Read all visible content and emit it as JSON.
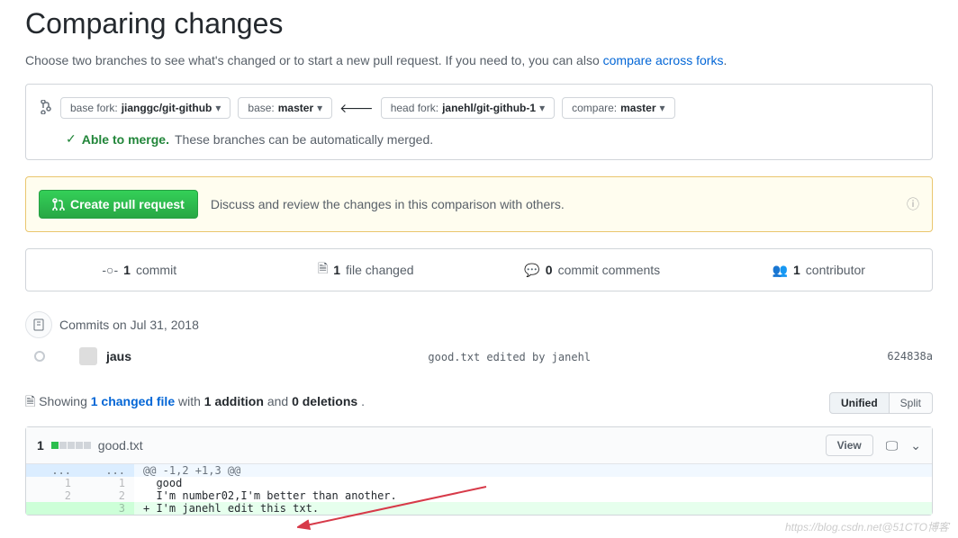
{
  "page": {
    "title": "Comparing changes",
    "subtitle_prefix": "Choose two branches to see what's changed or to start a new pull request. If you need to, you can also ",
    "compare_link": "compare across forks",
    "period": "."
  },
  "compare": {
    "base_fork_label": "base fork:",
    "base_fork_value": "jianggc/git-github",
    "base_label": "base:",
    "base_value": "master",
    "head_fork_label": "head fork:",
    "head_fork_value": "janehl/git-github-1",
    "compare_label": "compare:",
    "compare_value": "master"
  },
  "merge": {
    "status": "Able to merge.",
    "detail": "These branches can be automatically merged."
  },
  "pr": {
    "button": "Create pull request",
    "text": "Discuss and review the changes in this comparison with others."
  },
  "tabs": {
    "commits_count": "1",
    "commits_label": "commit",
    "files_count": "1",
    "files_label": "file changed",
    "comments_count": "0",
    "comments_label": "commit comments",
    "contrib_count": "1",
    "contrib_label": "contributor"
  },
  "commits": {
    "date_label": "Commits on Jul 31, 2018",
    "items": [
      {
        "author": "jaus",
        "message": "good.txt edited by janehl",
        "sha": "624838a"
      }
    ]
  },
  "changes": {
    "showing": "Showing ",
    "file_link": "1 changed file",
    "with": " with ",
    "additions": "1 addition",
    "and": " and ",
    "deletions": "0 deletions",
    "period": ".",
    "unified": "Unified",
    "split": "Split"
  },
  "file": {
    "count": "1",
    "name": "good.txt",
    "view": "View",
    "hunk": "@@ -1,2 +1,3 @@",
    "lines": [
      {
        "old": "1",
        "new": "1",
        "code": "  good",
        "type": "ctx"
      },
      {
        "old": "2",
        "new": "2",
        "code": "  I'm number02,I'm better than another.",
        "type": "ctx"
      },
      {
        "old": "",
        "new": "3",
        "code": "+ I'm janehl edit this txt.",
        "type": "add"
      }
    ]
  },
  "watermark": "https://blog.csdn.net@51CTO博客"
}
